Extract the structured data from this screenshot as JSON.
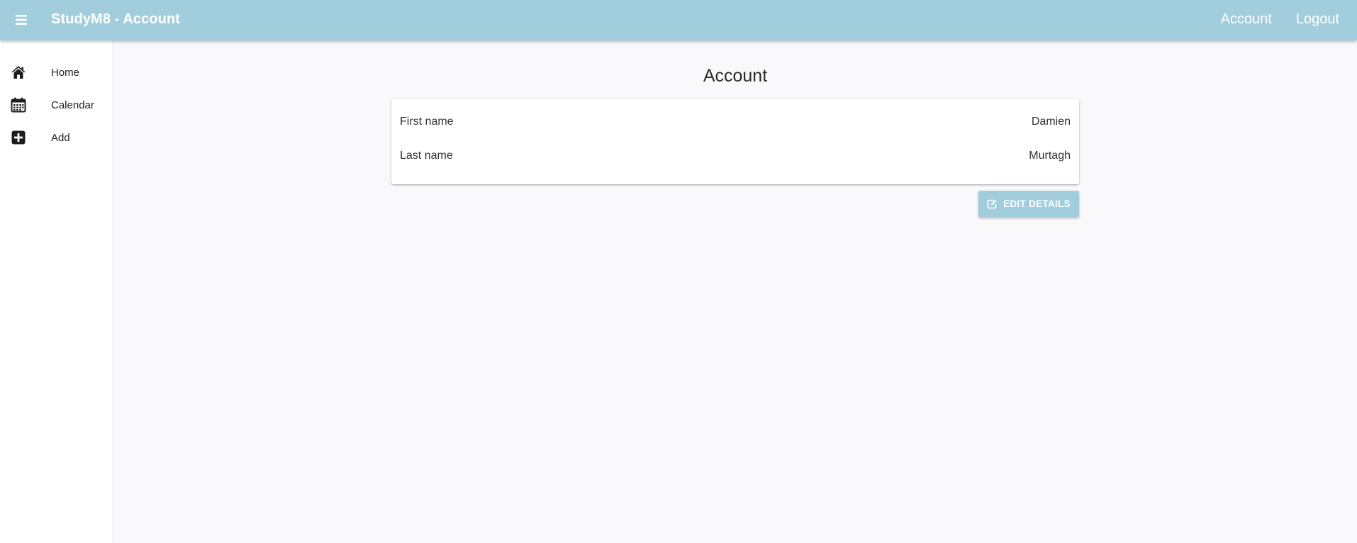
{
  "header": {
    "menu_icon": "hamburger-menu-icon",
    "title": "StudyM8 - Account",
    "nav": [
      {
        "label": "Account"
      },
      {
        "label": "Logout"
      }
    ]
  },
  "sidebar": {
    "items": [
      {
        "label": "Home",
        "icon": "home-icon"
      },
      {
        "label": "Calendar",
        "icon": "calendar-icon"
      },
      {
        "label": "Add",
        "icon": "plus-square-icon"
      }
    ]
  },
  "main": {
    "title": "Account",
    "fields": [
      {
        "label": "First name",
        "value": "Damien"
      },
      {
        "label": "Last name",
        "value": "Murtagh"
      }
    ],
    "edit_button": {
      "label": "EDIT DETAILS",
      "icon": "edit-icon"
    }
  },
  "colors": {
    "header_bg": "#a2cddc",
    "page_bg": "#f9f9fb",
    "card_bg": "#ffffff",
    "button_bg": "#a2cddc"
  }
}
